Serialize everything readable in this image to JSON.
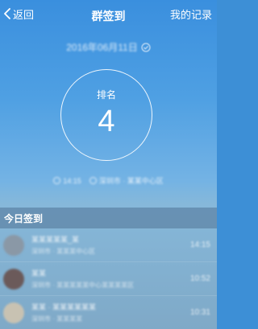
{
  "header": {
    "back_label": "返回",
    "title": "群签到",
    "records_label": "我的记录"
  },
  "date": {
    "text": "2016年06月11日",
    "icon": "check-circle-icon"
  },
  "rank": {
    "label": "排名",
    "value": "4"
  },
  "info": {
    "time": "14:15",
    "location": "深圳市 · 某某中心区"
  },
  "section": {
    "title": "今日签到"
  },
  "checkins": [
    {
      "name": "某某某某某_某",
      "sub": "深圳市 · 某某某中心区",
      "time": "14:15",
      "avatar_color": "#8a98a6"
    },
    {
      "name": "某某",
      "sub": "深圳市 · 某某某某某中心某某某某区",
      "time": "10:52",
      "avatar_color": "#6b5a5a"
    },
    {
      "name": "某某 · 某某某某某某",
      "sub": "深圳市 · 某某某某",
      "time": "10:31",
      "avatar_color": "#c8c2b2"
    }
  ],
  "colors": {
    "primary_blue": "#3a8fde",
    "section_bg": "#5b7e9f"
  }
}
